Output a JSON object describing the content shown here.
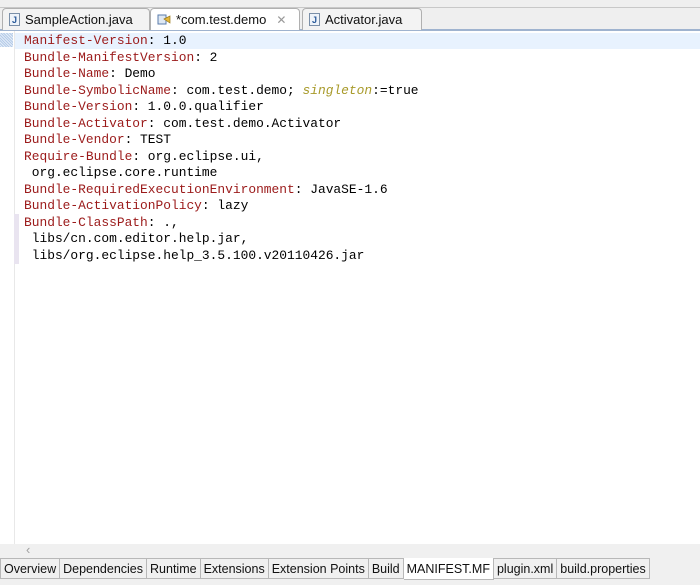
{
  "editor_tabs": [
    {
      "label": "SampleAction.java",
      "icon": "java-file-icon"
    },
    {
      "label": "*com.test.demo",
      "icon": "plugin-manifest-icon",
      "active": true,
      "close": "✕"
    },
    {
      "label": "Activator.java",
      "icon": "java-file-icon"
    }
  ],
  "lines": [
    {
      "key": "Manifest-Version",
      "value": ": 1.0"
    },
    {
      "key": "Bundle-ManifestVersion",
      "value": ": 2"
    },
    {
      "key": "Bundle-Name",
      "value": ": Demo"
    },
    {
      "key": "Bundle-SymbolicName",
      "value": ": com.test.demo; ",
      "attr": "singleton",
      "rest": ":=true"
    },
    {
      "key": "Bundle-Version",
      "value": ": 1.0.0.qualifier"
    },
    {
      "key": "Bundle-Activator",
      "value": ": com.test.demo.Activator"
    },
    {
      "key": "Bundle-Vendor",
      "value": ": TEST"
    },
    {
      "key": "Require-Bundle",
      "value": ": org.eclipse.ui,"
    },
    {
      "key": "",
      "value": " org.eclipse.core.runtime"
    },
    {
      "key": "Bundle-RequiredExecutionEnvironment",
      "value": ": JavaSE-1.6"
    },
    {
      "key": "Bundle-ActivationPolicy",
      "value": ": lazy"
    },
    {
      "key": "Bundle-ClassPath",
      "value": ": .,"
    },
    {
      "key": "",
      "value": " libs/cn.com.editor.help.jar,"
    },
    {
      "key": "",
      "value": " libs/org.eclipse.help_3.5.100.v20110426.jar"
    }
  ],
  "scroll_left": "‹",
  "bottom_tabs": [
    "Overview",
    "Dependencies",
    "Runtime",
    "Extensions",
    "Extension Points",
    "Build",
    "MANIFEST.MF",
    "plugin.xml",
    "build.properties"
  ],
  "active_bottom_tab": "MANIFEST.MF"
}
